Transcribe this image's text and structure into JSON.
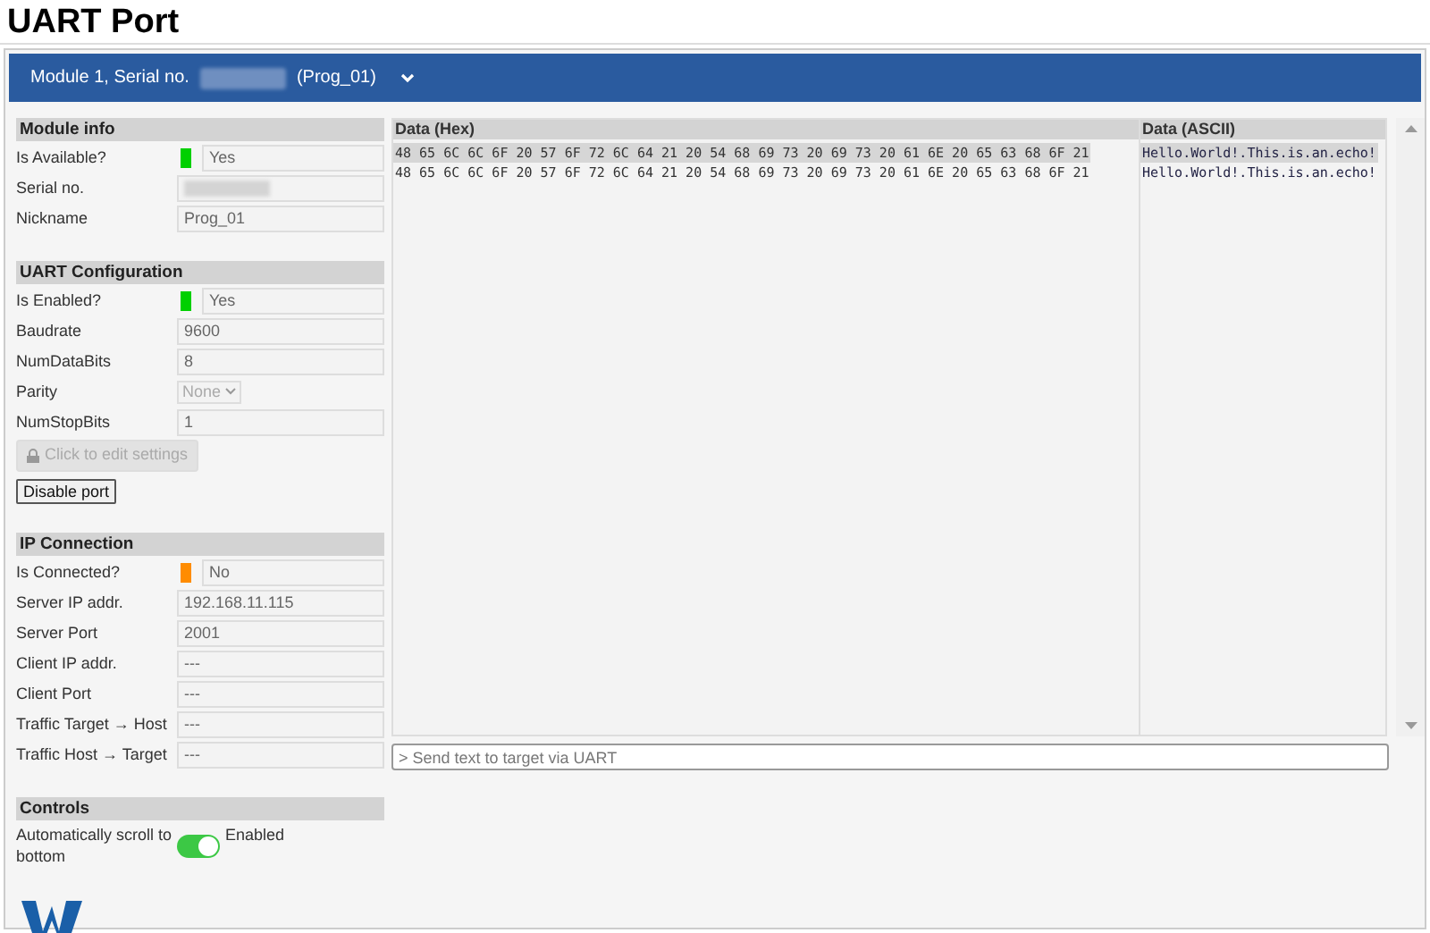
{
  "page_title": "UART Port",
  "module_bar": {
    "prefix": "Module 1, Serial no.",
    "suffix": "(Prog_01)",
    "expanded": false
  },
  "sections": [
    {
      "title": "Module info",
      "rows": [
        {
          "label": "Is Available?",
          "kind": "status",
          "color": "#00d000",
          "value": "Yes"
        },
        {
          "label": "Serial no.",
          "kind": "blurred"
        },
        {
          "label": "Nickname",
          "kind": "text",
          "value": "Prog_01"
        }
      ]
    },
    {
      "title": "UART Configuration",
      "rows": [
        {
          "label": "Is Enabled?",
          "kind": "status",
          "color": "#00d000",
          "value": "Yes"
        },
        {
          "label": "Baudrate",
          "kind": "text",
          "value": "9600"
        },
        {
          "label": "NumDataBits",
          "kind": "text",
          "value": "8"
        },
        {
          "label": "Parity",
          "kind": "select",
          "value": "None",
          "disabled": true
        },
        {
          "label": "NumStopBits",
          "kind": "text",
          "value": "1"
        }
      ],
      "buttons": [
        {
          "label": "Click to edit settings",
          "kind": "lock",
          "disabled": true
        },
        {
          "label": "Disable port",
          "kind": "plain",
          "disabled": false
        }
      ]
    },
    {
      "title": "IP Connection",
      "rows": [
        {
          "label": "Is Connected?",
          "kind": "status",
          "color": "#ff8c00",
          "value": "No"
        },
        {
          "label": "Server IP addr.",
          "kind": "text",
          "value": "192.168.11.115"
        },
        {
          "label": "Server Port",
          "kind": "text",
          "value": "2001"
        },
        {
          "label": "Client IP addr.",
          "kind": "text",
          "value": "---"
        },
        {
          "label": "Client Port",
          "kind": "text",
          "value": "---"
        },
        {
          "label": "Traffic Target → Host",
          "kind": "text",
          "value": "---"
        },
        {
          "label": "Traffic Host → Target",
          "kind": "text",
          "value": "---"
        }
      ]
    },
    {
      "title": "Controls",
      "rows": [
        {
          "label": "Automatically scroll to bottom",
          "kind": "toggle",
          "on": true,
          "value": "Enabled"
        }
      ]
    }
  ],
  "data": {
    "hex_header": "Data (Hex)",
    "ascii_header": "Data (ASCII)",
    "rows": [
      {
        "hex": "48 65 6C 6C 6F 20 57 6F 72 6C 64 21 20 54 68 69 73 20 69 73 20 61 6E 20 65 63 68 6F 21",
        "ascii": "Hello.World!.This.is.an.echo!",
        "selected": true
      },
      {
        "hex": "48 65 6C 6C 6F 20 57 6F 72 6C 64 21 20 54 68 69 73 20 69 73 20 61 6E 20 65 63 68 6F 21",
        "ascii": "Hello.World!.This.is.an.echo!",
        "selected": false
      }
    ]
  },
  "send": {
    "placeholder": "> Send text to target via UART"
  }
}
